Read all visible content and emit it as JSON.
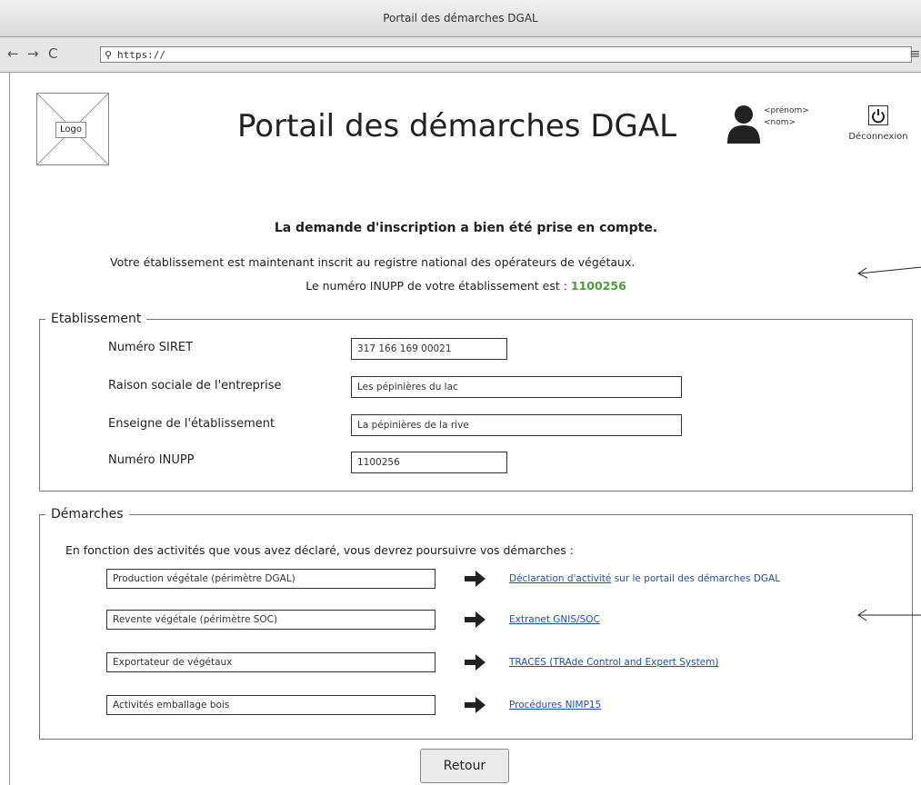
{
  "window": {
    "title": "Portail des démarches DGAL"
  },
  "browser": {
    "back": "←",
    "forward": "→",
    "reload": "C",
    "search_glyph": "⚲",
    "url": "https://",
    "menu": "≡"
  },
  "header": {
    "logo_label": "Logo",
    "title": "Portail des démarches DGAL",
    "user": {
      "firstname": "<prénom>",
      "lastname": "<nom>"
    },
    "logout_label": "Déconnexion"
  },
  "confirmation": {
    "line1": "La demande d'inscription a bien été prise en compte.",
    "line2": "Votre établissement est maintenant inscrit au registre national des opérateurs de végétaux.",
    "line3_prefix": "Le numéro INUPP de votre établissement est :",
    "inupp": "1100256"
  },
  "etablissement": {
    "legend": "Etablissement",
    "fields": [
      {
        "label": "Numéro SIRET",
        "value": "317 166 169 00021"
      },
      {
        "label": "Raison sociale de l'entreprise",
        "value": "Les pépinières du lac"
      },
      {
        "label": "Enseigne de l'établissement",
        "value": "La pépinières de la rive"
      },
      {
        "label": "Numéro INUPP",
        "value": "1100256"
      }
    ]
  },
  "demarches": {
    "legend": "Démarches",
    "intro": "En fonction des activités que vous avez déclaré, vous devrez poursuivre vos démarches :",
    "activities": [
      {
        "activity": "Production végétale (périmètre DGAL)",
        "link": "Déclaration d'activité",
        "link_suffix": " sur le portail des démarches DGAL"
      },
      {
        "activity": "Revente végétale (périmètre SOC)",
        "link": "Extranet GNIS/SOC",
        "link_suffix": ""
      },
      {
        "activity": "Exportateur de végétaux",
        "link": "TRACES (TRAde Control and Expert System)",
        "link_suffix": ""
      },
      {
        "activity": "Activités emballage bois",
        "link": "Procédures NIMP15",
        "link_suffix": ""
      }
    ]
  },
  "footer": {
    "retour_label": "Retour"
  },
  "colors": {
    "inupp_highlight": "#4a9d3a",
    "link": "#1f4fa8"
  },
  "icons": [
    "user-icon",
    "power-icon",
    "arrow-right-icon",
    "search-icon",
    "menu-icon"
  ]
}
